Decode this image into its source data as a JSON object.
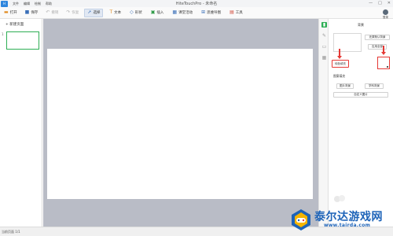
{
  "menubar": {
    "logo_text": "H",
    "items": [
      "文件",
      "编辑",
      "绘制",
      "帮助"
    ],
    "title": "HiteTouchPro - 未命名",
    "controls": [
      "—",
      "□",
      "✕"
    ]
  },
  "toolbar": {
    "open": "打开",
    "save": "保存",
    "undo": "撤销",
    "redo": "恢复",
    "select": "选择",
    "text": "文本",
    "shape": "形状",
    "insert": "插入",
    "classroom": "课堂活动",
    "mindmap": "思维导图",
    "tools": "工具",
    "user": "登录"
  },
  "left_panel": {
    "new_page": "+ 新建页面",
    "page_number": "1"
  },
  "props": {
    "title": "背景",
    "apply_default": "还原默认背景",
    "apply_all": "应用全部",
    "pure_color": "纯色填充",
    "image_fill": "图案填充",
    "image_bg": "图片背景",
    "subject_bg": "学科背景",
    "custom_image": "自定义图片"
  },
  "status": {
    "text": "当前页面 1/1"
  },
  "watermark": {
    "title": "泰尔达游戏网",
    "url": "www.tairda.com"
  },
  "colors": {
    "accent_green": "#2eae55",
    "highlight_red": "#e53935",
    "watermark_blue": "#1d63b8"
  },
  "icons": {
    "strip": [
      "page-bg-icon",
      "brush-icon",
      "save-icon",
      "grid-icon"
    ]
  }
}
